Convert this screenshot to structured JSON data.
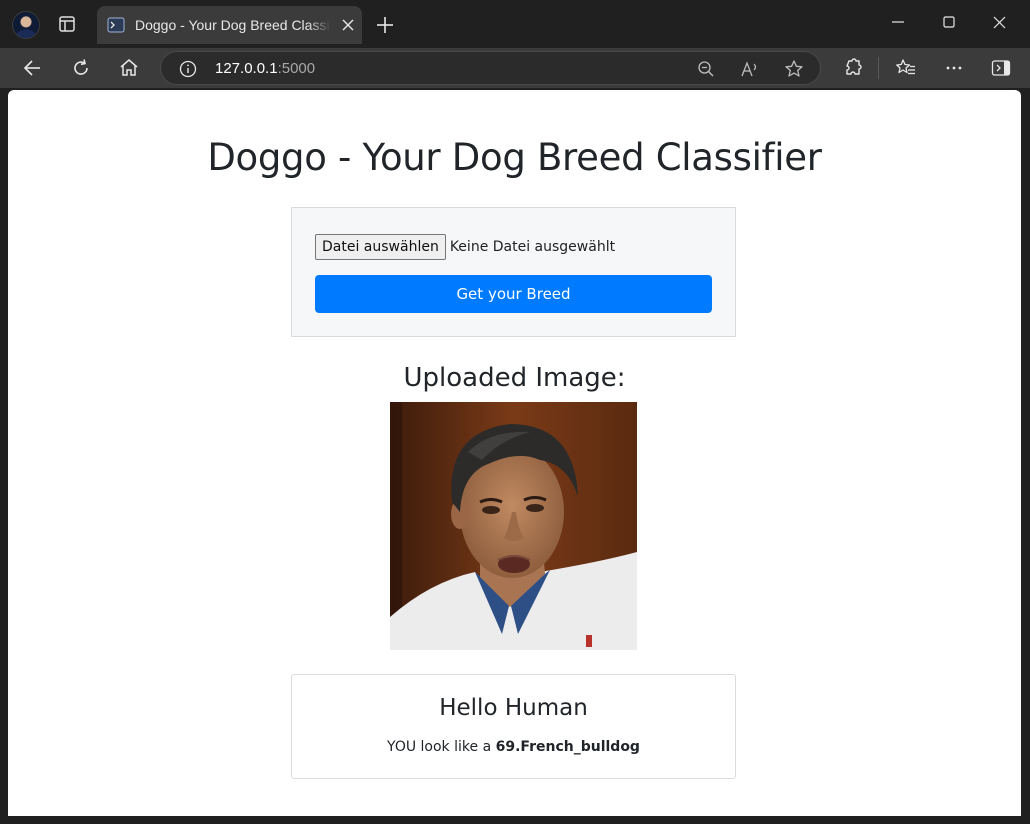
{
  "browser": {
    "tab_title": "Doggo - Your Dog Breed Classifier",
    "address_host": "127.0.0.1",
    "address_port": ":5000"
  },
  "page": {
    "title": "Doggo - Your Dog Breed Classifier",
    "upload": {
      "file_button_label": "Datei auswählen",
      "file_status": "Keine Datei ausgewählt",
      "submit_label": "Get your Breed"
    },
    "uploaded_heading": "Uploaded Image:",
    "result": {
      "greeting": "Hello Human",
      "prefix": "YOU look like a",
      "breed": "69.French_bulldog"
    }
  },
  "colors": {
    "primary_button": "#007bff",
    "browser_frame": "#202020",
    "toolbar": "#3b3b3b"
  }
}
